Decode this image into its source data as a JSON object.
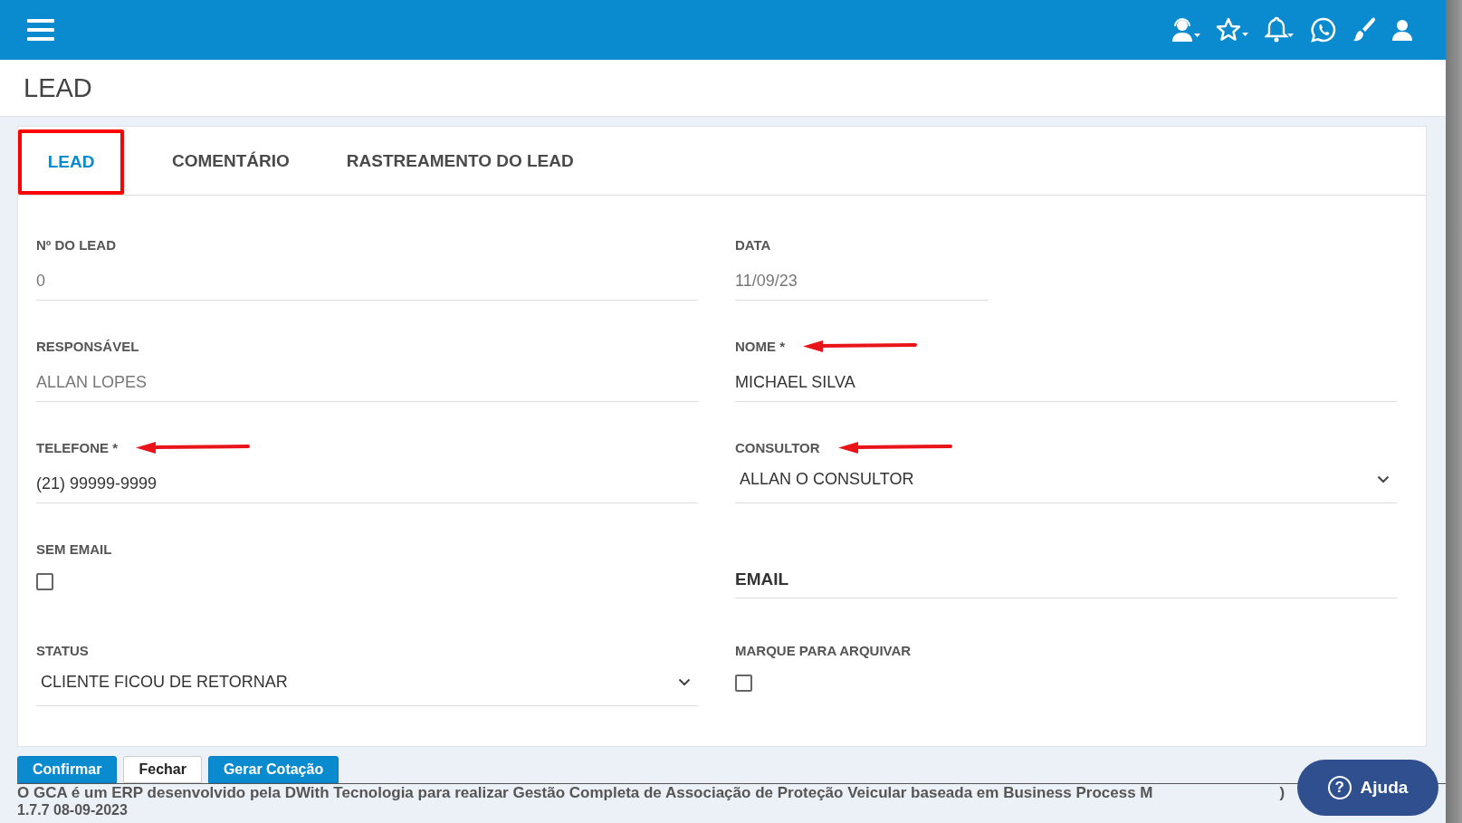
{
  "page_title": "LEAD",
  "tabs": [
    {
      "label": "LEAD",
      "selected": true,
      "highlighted": true
    },
    {
      "label": "COMENTÁRIO",
      "selected": false,
      "highlighted": false
    },
    {
      "label": "RASTREAMENTO DO LEAD",
      "selected": false,
      "highlighted": false
    }
  ],
  "form_rows": [
    {
      "left": {
        "kind": "text",
        "label": "Nº DO LEAD",
        "value": "0",
        "readonly": true
      },
      "right": {
        "kind": "text",
        "label": "DATA",
        "value": "11/09/23",
        "readonly": true,
        "narrow": true
      }
    },
    {
      "left": {
        "kind": "text",
        "label": "RESPONSÁVEL",
        "value": "ALLAN LOPES",
        "readonly": true
      },
      "right": {
        "kind": "text",
        "label": "NOME *",
        "value": "MICHAEL SILVA",
        "readonly": false,
        "arrow": true
      }
    },
    {
      "left": {
        "kind": "text",
        "label": "TELEFONE *",
        "value": "(21) 99999-9999",
        "readonly": false,
        "arrow": true
      },
      "right": {
        "kind": "select",
        "label": "CONSULTOR",
        "value": "ALLAN O CONSULTOR",
        "arrow": true
      }
    },
    {
      "left": {
        "kind": "checkbox",
        "label": "SEM EMAIL",
        "checked": false
      },
      "right": {
        "kind": "heading",
        "label": "EMAIL"
      }
    },
    {
      "left": {
        "kind": "select",
        "label": "STATUS",
        "value": "CLIENTE FICOU DE RETORNAR"
      },
      "right": {
        "kind": "checkbox",
        "label": "MARQUE PARA ARQUIVAR",
        "checked": false
      }
    }
  ],
  "buttons": [
    {
      "label": "Confirmar",
      "kind": "primary"
    },
    {
      "label": "Fechar",
      "kind": "default"
    },
    {
      "label": "Gerar Cotação",
      "kind": "primary"
    }
  ],
  "footer": {
    "text": "O GCA é um ERP desenvolvido pela DWith Tecnologia para realizar Gestão Completa de Associação de Proteção Veicular baseada em Business Process M",
    "text_end": ")",
    "version": "1.7.7 08-09-2023"
  },
  "help_button": {
    "label": "Ajuda",
    "icon": "?"
  }
}
